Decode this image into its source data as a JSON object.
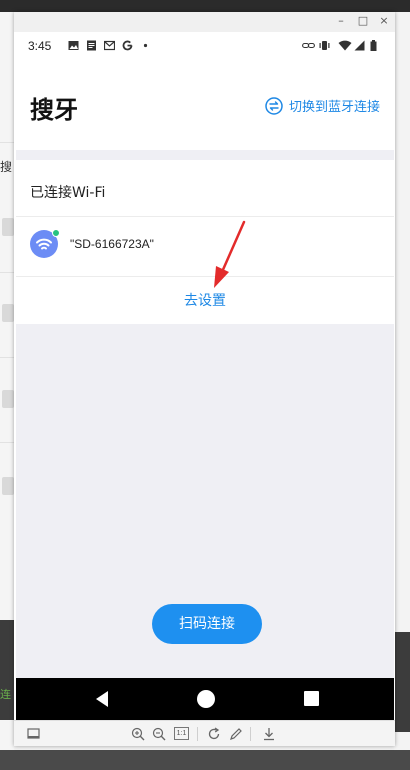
{
  "background": {
    "left_text": "搜",
    "left_green_text": "连"
  },
  "emulator": {
    "window_controls": [
      "–",
      "□",
      "×"
    ]
  },
  "status_bar": {
    "time": "3:45",
    "left_icons": [
      "image-icon",
      "document-icon",
      "mail-icon",
      "google-icon",
      "dot-icon"
    ],
    "right_icons": [
      "link-icon",
      "vibrate-icon",
      "wifi-icon",
      "signal-icon",
      "battery-icon"
    ]
  },
  "app_bar": {
    "title": "搜牙",
    "switch_label": "切换到蓝牙连接",
    "switch_icon": "swap-icon"
  },
  "connected_card": {
    "header": "已连接Wi-Fi",
    "wifi_name": "\"SD-6166723A\"",
    "wifi_icon": "wifi-icon",
    "goto_settings": "去设置"
  },
  "scan_button": {
    "label": "扫码连接"
  },
  "nav_bar": {
    "icons": [
      "back-icon",
      "home-icon",
      "recent-apps-icon"
    ]
  },
  "toolbar": {
    "icons": [
      "screen-icon",
      "zoom-in-icon",
      "zoom-out-icon",
      "actual-size-icon",
      "rotate-icon",
      "edit-icon",
      "download-icon"
    ],
    "actual_size_label": "1:1"
  },
  "colors": {
    "accent": "#1e88e5",
    "button": "#1e90f0",
    "wifi_badge": "#6c8cf5",
    "wifi_dot": "#27c281",
    "arrow": "#e32b2b"
  }
}
